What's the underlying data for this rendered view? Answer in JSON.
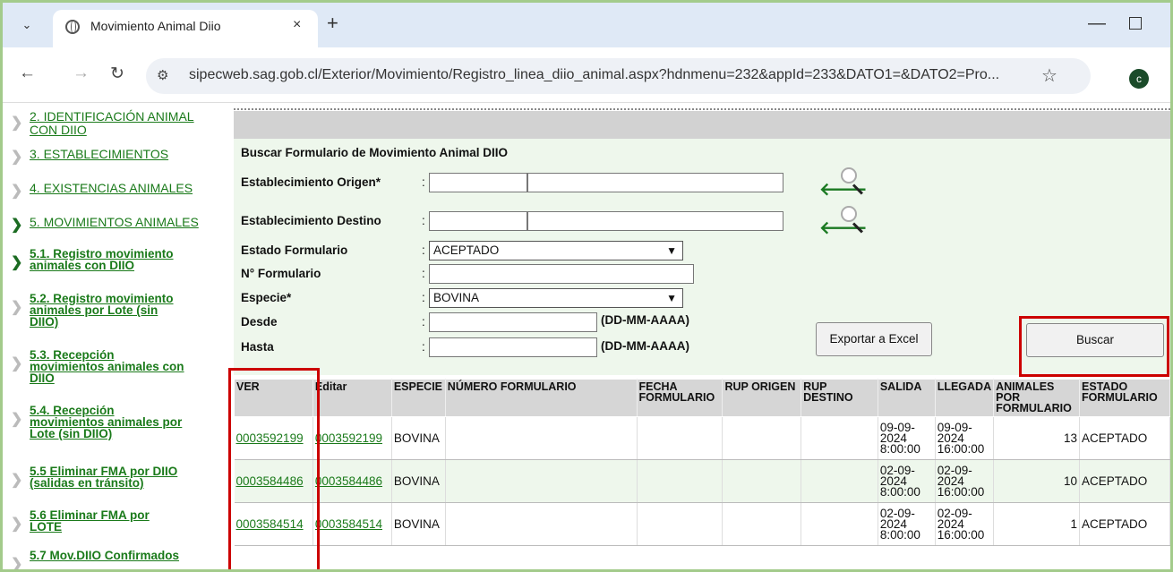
{
  "browser": {
    "tab_title": "Movimiento Animal Diio",
    "tab_close": "×",
    "new_tab": "+",
    "tab_list": "⌄",
    "url": "sipecweb.sag.gob.cl/Exterior/Movimiento/Registro_linea_diio_animal.aspx?hdnmenu=232&appId=233&DATO1=&DATO2=Pro...",
    "profile_initial": "c"
  },
  "sidebar": {
    "items": [
      {
        "label_lines": [
          "2. IDENTIFICACIÓN ANIMAL",
          "CON DIIO"
        ]
      },
      {
        "label_lines": [
          "3. ESTABLECIMIENTOS"
        ]
      },
      {
        "label_lines": [
          "4. EXISTENCIAS ANIMALES"
        ]
      },
      {
        "label_lines": [
          "5. MOVIMIENTOS ANIMALES"
        ]
      }
    ],
    "subitems": [
      {
        "label_lines": [
          "5.1. Registro movimiento",
          "animales con DIIO"
        ]
      },
      {
        "label_lines": [
          "5.2. Registro movimiento",
          "animales por Lote (sin",
          "DIIO)"
        ]
      },
      {
        "label_lines": [
          "5.3. Recepción",
          "movimientos animales con",
          "DIIO"
        ]
      },
      {
        "label_lines": [
          "5.4. Recepción",
          "movimientos animales por",
          "Lote (sin DIIO)"
        ]
      },
      {
        "label_lines": [
          "5.5 Eliminar FMA por DIIO",
          "(salidas en tránsito)"
        ]
      },
      {
        "label_lines": [
          "5.6 Eliminar FMA por",
          "LOTE"
        ]
      },
      {
        "label_lines": [
          "5.7 Mov.DIIO Confirmados"
        ]
      }
    ]
  },
  "form": {
    "title": "Buscar  Formulario de Movimiento Animal DIIO",
    "labels": {
      "origen": "Establecimiento Origen*",
      "destino": "Establecimiento Destino",
      "estado": "Estado Formulario",
      "numero": "N° Formulario",
      "especie": "Especie*",
      "desde": "Desde",
      "hasta": "Hasta"
    },
    "colon": ":",
    "estado_value": "ACEPTADO",
    "especie_value": "BOVINA",
    "date_hint": "(DD-MM-AAAA)",
    "export_button": "Exportar a Excel",
    "search_button": "Buscar"
  },
  "table": {
    "headers": [
      "VER",
      "Editar",
      "ESPECIE",
      "NÚMERO FORMULARIO",
      "FECHA FORMULARIO",
      "RUP ORIGEN",
      "RUP DESTINO",
      "SALIDA",
      "LLEGADA",
      "ANIMALES POR FORMULARIO",
      "ESTADO FORMULARIO"
    ],
    "rows": [
      {
        "ver": "0003592199",
        "editar": "0003592199",
        "especie": "BOVINA",
        "salida": [
          "09-09-",
          "2024",
          "8:00:00"
        ],
        "llegada": [
          "09-09-",
          "2024",
          "16:00:00"
        ],
        "animales": "13",
        "estado": "ACEPTADO"
      },
      {
        "ver": "0003584486",
        "editar": "0003584486",
        "especie": "BOVINA",
        "salida": [
          "02-09-",
          "2024",
          "8:00:00"
        ],
        "llegada": [
          "02-09-",
          "2024",
          "16:00:00"
        ],
        "animales": "10",
        "estado": "ACEPTADO"
      },
      {
        "ver": "0003584514",
        "editar": "0003584514",
        "especie": "BOVINA",
        "salida": [
          "02-09-",
          "2024",
          "8:00:00"
        ],
        "llegada": [
          "02-09-",
          "2024",
          "16:00:00"
        ],
        "animales": "1",
        "estado": "ACEPTADO"
      }
    ]
  },
  "colors": {
    "accent_green": "#1a7a1a",
    "highlight_red": "#cc0000",
    "form_bg": "#eef7ec"
  }
}
